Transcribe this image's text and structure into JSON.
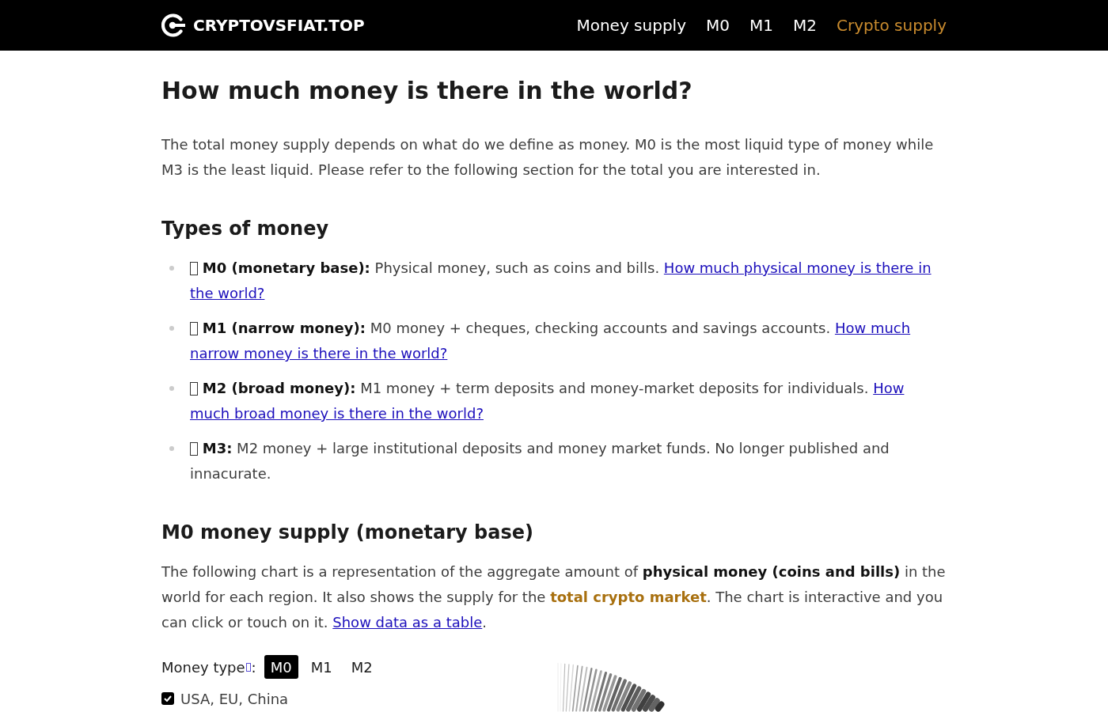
{
  "header": {
    "logo_text": "CRYPTOVSFIAT.TOP",
    "nav": [
      {
        "label": "Money supply",
        "kind": "page"
      },
      {
        "label": "M0",
        "kind": "page"
      },
      {
        "label": "M1",
        "kind": "page"
      },
      {
        "label": "M2",
        "kind": "page"
      },
      {
        "label": "Crypto supply",
        "kind": "crypto"
      }
    ]
  },
  "title": "How much money is there in the world?",
  "intro": "The total money supply depends on what do we define as money. M0 is the most liquid type of money while M3 is the least liquid. Please refer to the following section for the total you are interested in.",
  "types_of_money": {
    "heading": "Types of money",
    "items": [
      {
        "term": "M0 (monetary base):",
        "description": "Physical money, such as coins and bills.",
        "link_lines": [
          "How much physical money is there in",
          "the world?"
        ]
      },
      {
        "term": "M1 (narrow money):",
        "description": "M0 money + cheques, checking accounts and savings accounts.",
        "link_lines": [
          "How much",
          "narrow money is there in the world?"
        ]
      },
      {
        "term": "M2 (broad money):",
        "description": "M1 money + term deposits and money-market deposits for individuals.",
        "link_lines": [
          "How",
          "much broad money is there in the world?"
        ]
      },
      {
        "term": "M3:",
        "description": "M2 money + large institutional deposits and money market funds. No longer published and innacurate."
      }
    ]
  },
  "m0_section": {
    "heading": "M0 money supply (monetary base)",
    "paragraph": [
      {
        "kind": "plain",
        "text": "The following chart is a representation of the aggregate amount of "
      },
      {
        "kind": "bold",
        "text": "physical money (coins and bills)"
      },
      {
        "kind": "plain",
        "text": " in the world for each region. It also shows the supply for the "
      },
      {
        "kind": "crypto",
        "text": "total crypto market"
      },
      {
        "kind": "plain",
        "text": ". The chart is interactive and you can click or touch on it. "
      },
      {
        "kind": "link",
        "text": "Show data as a table"
      },
      {
        "kind": "plain",
        "text": "."
      }
    ],
    "money_type": {
      "label": "Money type",
      "separator": ":",
      "options": [
        {
          "label": "M0",
          "selected": true
        },
        {
          "label": "M1",
          "selected": false
        },
        {
          "label": "M2",
          "selected": false
        }
      ]
    },
    "regions": [
      {
        "label": "USA, EU, China",
        "checked": true
      }
    ]
  }
}
